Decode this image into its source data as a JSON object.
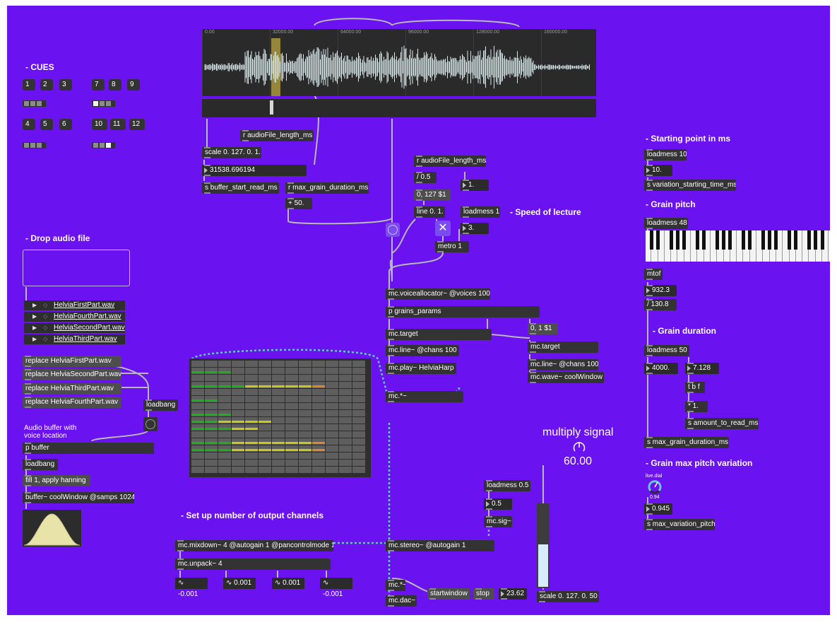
{
  "colors": {
    "patcher_bg": "#6a12f0",
    "box": "#333333",
    "cord": "#b9b9b9",
    "signal_cord": "#67c6c8",
    "selection": "#b8a640",
    "meter_green": "#19b019",
    "meter_yellow": "#c8c818",
    "meter_orange": "#e0862a"
  },
  "waveform": {
    "ticks": [
      "0.00",
      "32000.00",
      "64000.00",
      "96000.00",
      "128000.00",
      "160000.00"
    ]
  },
  "headings": {
    "cues": "- CUES",
    "drop": "- Drop audio file",
    "outputs": "- Set up number of output channels",
    "speed": "- Speed of lecture",
    "start": "- Starting point in ms",
    "pitch": "- Grain pitch",
    "duration": "- Grain duration",
    "maxpitch": "- Grain max pitch variation"
  },
  "cues": {
    "buttons": [
      "1",
      "2",
      "3",
      "7",
      "8",
      "9",
      "4",
      "5",
      "6",
      "10",
      "11",
      "12"
    ]
  },
  "files": [
    "HelviaFirstPart.wav",
    "HelviaFourthPart.wav",
    "HelviaSecondPart.wav",
    "HelviaThirdPart.wav"
  ],
  "replace": [
    "replace HelviaFirstPart.wav",
    "replace HelviaSecondPart.wav",
    "replace HelviaThirdPart.wav",
    "replace HelviaFourthPart.wav"
  ],
  "left": {
    "loadbang1": "loadbang",
    "comment": "Audio buffer with voice location",
    "pbuffer": "p buffer",
    "loadbang2": "loadbang",
    "fill": "fill 1, apply hanning",
    "buffer": "buffer~ coolWindow @samps 1024"
  },
  "top": {
    "recv_len": "r audioFile_length_ms",
    "scale": "scale 0. 127. 0. 1.",
    "num_start": "31538.696194",
    "send_start": "s buffer_start_read_ms",
    "recv_max": "r max_grain_duration_ms",
    "plus50": "+ 50."
  },
  "speed": {
    "recv_len": "r audioFile_length_ms",
    "div": "/ 0.5",
    "line_msg": "0, 127 $1",
    "num1": "1.",
    "line": "line 0. 1.",
    "loadmess": "loadmess 1",
    "num3": "3.",
    "metro": "metro 1"
  },
  "voice": {
    "allocator": "mc.voiceallocator~ @voices 100",
    "params": "p grains_params",
    "target1": "mc.target",
    "msg": "0, 1 $1",
    "target2": "mc.target",
    "line1": "mc.line~ @chans 100",
    "line2": "mc.line~ @chans 100",
    "play": "mc.play~ HelviaHarp",
    "wave": "mc.wave~ coolWindow",
    "mult": "mc.*~"
  },
  "right": {
    "lm10": "loadmess 10",
    "n10": "10.",
    "svar": "s variation_starting_time_ms",
    "lm48": "loadmess 48",
    "mtof": "mtof",
    "n932": "932.3",
    "div130": "/ 130.8",
    "lm50": "loadmess 50",
    "n4000": "4000.",
    "n7128": "7.128",
    "tbf": "t b f",
    "mul1": "* 1.",
    "samount": "s amount_to_read_ms",
    "smaxgrain": "s max_grain_duration_ms",
    "dial_label": "live.dial",
    "dial_value": "0.94",
    "n945": "0.945",
    "smaxvar": "s max_variation_pitch"
  },
  "mult": {
    "label": "multiply signal",
    "value": "60.00"
  },
  "bottom": {
    "mixdown": "mc.mixdown~ 4 @autogain 1 @pancontrolmode 1",
    "unpack": "mc.unpack~ 4",
    "sig": [
      "-0.001",
      "0.001",
      "0.001",
      "-0.001"
    ],
    "lm05": "loadmess 0.5",
    "n05": "0.5",
    "mcsig": "mc.sig~",
    "stereo": "mc.stereo~ @autogain 1",
    "mul": "mc.*~",
    "dac": "mc.dac~",
    "startwindow": "startwindow",
    "stop": "stop",
    "n2362": "23.62",
    "scale": "scale 0. 127. 0. 50"
  },
  "matrix": {
    "cols": 13,
    "rows": 16,
    "cells": [
      [
        2,
        1,
        1
      ],
      [
        2,
        2,
        1
      ],
      [
        2,
        3,
        1
      ],
      [
        4,
        1,
        1
      ],
      [
        4,
        2,
        1
      ],
      [
        4,
        3,
        1
      ],
      [
        4,
        4,
        1
      ],
      [
        4,
        5,
        2
      ],
      [
        4,
        6,
        2
      ],
      [
        4,
        7,
        2
      ],
      [
        4,
        8,
        2
      ],
      [
        4,
        9,
        2
      ],
      [
        4,
        10,
        3
      ],
      [
        6,
        1,
        1
      ],
      [
        6,
        2,
        1
      ],
      [
        8,
        1,
        1
      ],
      [
        8,
        2,
        1
      ],
      [
        8,
        3,
        1
      ],
      [
        9,
        1,
        1
      ],
      [
        9,
        2,
        1
      ],
      [
        9,
        3,
        2
      ],
      [
        9,
        4,
        2
      ],
      [
        9,
        5,
        2
      ],
      [
        9,
        6,
        2
      ],
      [
        10,
        1,
        1
      ],
      [
        10,
        2,
        1
      ],
      [
        10,
        3,
        1
      ],
      [
        10,
        4,
        2
      ],
      [
        10,
        5,
        2
      ],
      [
        12,
        1,
        1
      ],
      [
        12,
        2,
        1
      ],
      [
        12,
        3,
        1
      ],
      [
        12,
        4,
        2
      ],
      [
        12,
        5,
        2
      ],
      [
        12,
        6,
        2
      ],
      [
        12,
        7,
        2
      ],
      [
        12,
        8,
        2
      ],
      [
        12,
        9,
        2
      ],
      [
        12,
        10,
        3
      ],
      [
        13,
        1,
        1
      ],
      [
        13,
        2,
        1
      ],
      [
        13,
        3,
        1
      ],
      [
        13,
        4,
        2
      ],
      [
        13,
        5,
        2
      ],
      [
        13,
        6,
        2
      ],
      [
        13,
        7,
        2
      ],
      [
        13,
        8,
        2
      ],
      [
        13,
        9,
        2
      ],
      [
        13,
        10,
        3
      ]
    ]
  },
  "slider": {
    "level": 0.52
  }
}
